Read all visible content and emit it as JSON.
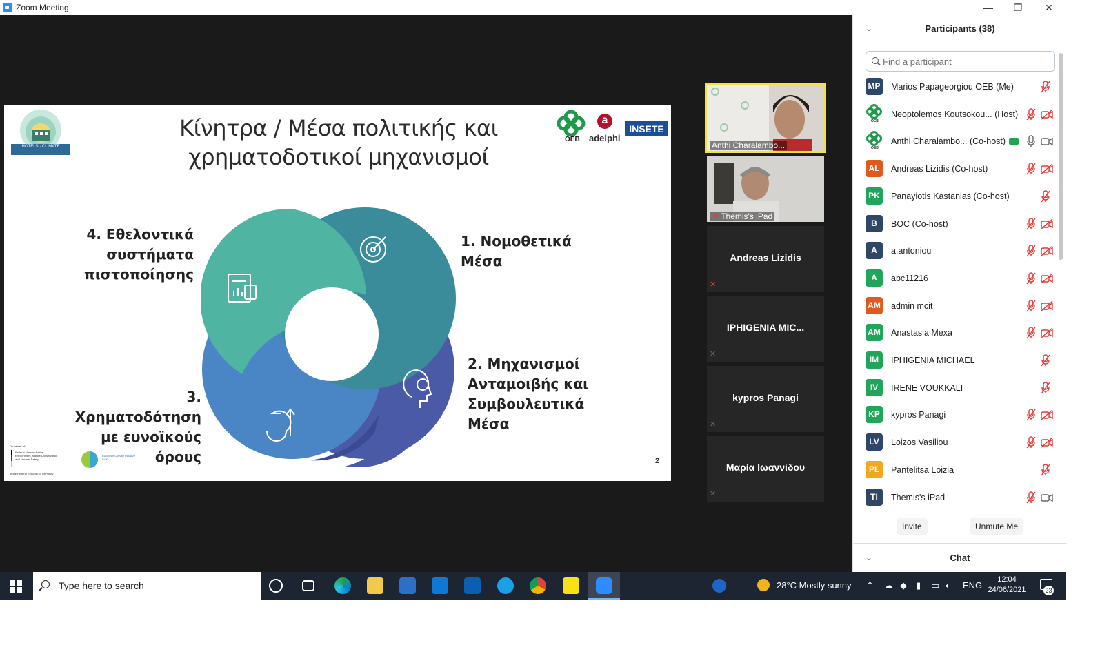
{
  "window": {
    "title": "Zoom Meeting",
    "minimize": "—",
    "maximize": "❐",
    "close": "✕"
  },
  "slide": {
    "title_line1": "Κίνητρα / Μέσα πολιτικής και",
    "title_line2": "χρηματοδοτικοί μηχανισμοί",
    "segments": [
      {
        "line1": "1. Νομοθετικά",
        "line2": "Μέσα",
        "color": "#3a8c9b"
      },
      {
        "line1": "2. Μηχανισμοί",
        "line2": "Ανταμοιβής και",
        "line3": "Συμβουλευτικά",
        "line4": "Μέσα",
        "color": "#4b5aa6"
      },
      {
        "line1": "3. Χρηματοδότηση",
        "line2": "με ευνοϊκούς όρους",
        "color": "#4a86c5"
      },
      {
        "line1": "4. Εθελοντικά",
        "line2": "συστήματα",
        "line3": "πιστοποίησης",
        "color": "#4fb4a2"
      }
    ],
    "page_number": "2",
    "logos": {
      "oeb": "OEB",
      "adelphi": "adelphi",
      "adelphi_mark": "a",
      "insete": "INSETE"
    },
    "footer": {
      "on_behalf": "On behalf of:",
      "ministry": "Federal Ministry for the Environment, Nature Conservation and Nuclear Safety",
      "republic": "of the Federal Republic of Germany",
      "euki": "European Climate Initiative EUKI"
    }
  },
  "video_tiles": [
    {
      "label": "Anthi Charalambo...",
      "active": true
    },
    {
      "label": "Themis's iPad",
      "active": false
    },
    {
      "name": "Andreas Lizidis"
    },
    {
      "name": "IPHIGENIA  MIC..."
    },
    {
      "name": "kypros Panagi"
    },
    {
      "name": "Μαρία Ιωαννίδου"
    }
  ],
  "participants": {
    "header": "Participants (38)",
    "search_placeholder": "Find a participant",
    "list": [
      {
        "initials": "MP",
        "name": "Marios Papageorgiou OEB (Me)",
        "color": "#2f4766",
        "mic": "muted",
        "cam": "none"
      },
      {
        "initials": "",
        "name": "Neoptolemos Koutsokou... (Host)",
        "color": "oeb",
        "mic": "muted",
        "cam": "off"
      },
      {
        "initials": "",
        "name": "Anthi Charalambo... (Co-host)",
        "color": "oeb",
        "mic": "on",
        "cam": "on",
        "sharing": true
      },
      {
        "initials": "AL",
        "name": "Andreas Lizidis (Co-host)",
        "color": "#e05a1e",
        "mic": "muted",
        "cam": "off"
      },
      {
        "initials": "PK",
        "name": "Panayiotis Kastanias (Co-host)",
        "color": "#20a65a",
        "mic": "muted",
        "cam": "none"
      },
      {
        "initials": "B",
        "name": "BOC (Co-host)",
        "color": "#2f4766",
        "mic": "muted",
        "cam": "off"
      },
      {
        "initials": "A",
        "name": "a.antoniou",
        "color": "#2f4766",
        "mic": "muted",
        "cam": "off"
      },
      {
        "initials": "A",
        "name": "abc11216",
        "color": "#20a65a",
        "mic": "muted",
        "cam": "off"
      },
      {
        "initials": "AM",
        "name": "admin mcit",
        "color": "#e05a1e",
        "mic": "muted",
        "cam": "off"
      },
      {
        "initials": "AM",
        "name": "Anastasia Mexa",
        "color": "#20a65a",
        "mic": "muted",
        "cam": "off"
      },
      {
        "initials": "IM",
        "name": "IPHIGENIA MICHAEL",
        "color": "#20a65a",
        "mic": "muted",
        "cam": "none"
      },
      {
        "initials": "IV",
        "name": "IRENE VOUKKALI",
        "color": "#20a65a",
        "mic": "muted",
        "cam": "none"
      },
      {
        "initials": "KP",
        "name": "kypros Panagi",
        "color": "#20a65a",
        "mic": "muted",
        "cam": "off"
      },
      {
        "initials": "LV",
        "name": "Loizos Vasiliou",
        "color": "#2f4766",
        "mic": "muted",
        "cam": "off"
      },
      {
        "initials": "PL",
        "name": "Pantelitsa Loizia",
        "color": "#f2a71e",
        "mic": "muted",
        "cam": "none"
      },
      {
        "initials": "TI",
        "name": "Themis's iPad",
        "color": "#2f4766",
        "mic": "muted",
        "cam": "on"
      }
    ],
    "invite_label": "Invite",
    "unmute_label": "Unmute Me",
    "chat_label": "Chat"
  },
  "taskbar": {
    "search_text": "Type here to search",
    "weather": "28°C  Mostly sunny",
    "lang": "ENG",
    "time": "12:04",
    "date": "24/06/2021",
    "notifications": "23"
  }
}
